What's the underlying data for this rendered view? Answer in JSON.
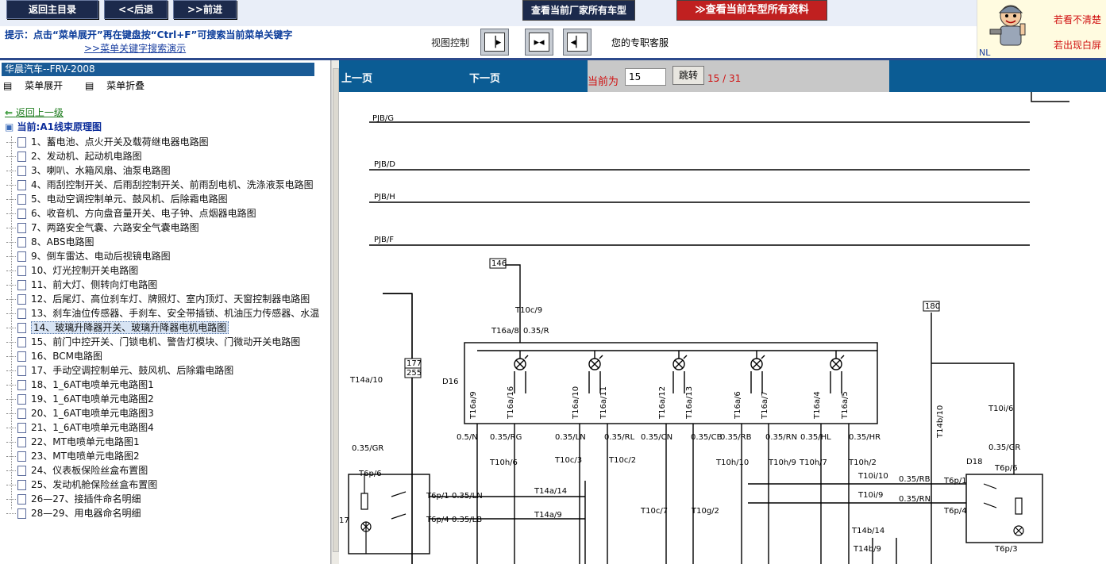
{
  "toolbar": {
    "home": "返回主目录",
    "back": "<<后退",
    "forward": ">>前进",
    "all_models": "查看当前厂家所有车型",
    "all_docs": "查看当前车型所有资料"
  },
  "hint": {
    "text": "提示：点击“菜单展开”再在键盘按“Ctrl+F”可搜索当前菜单关键字",
    "link": ">>菜单关键字搜索演示"
  },
  "view_control": {
    "label": "视图控制"
  },
  "service": "您的专职客服",
  "ad": {
    "line1": "若看不清楚",
    "line2": "若出现白屏",
    "nl": "NL"
  },
  "tree": {
    "title": "华晨汽车--FRV-2008",
    "expand": "菜单展开",
    "collapse": "菜单折叠",
    "back": "返回上一级",
    "current": "当前:A1线束原理图",
    "items": [
      "1、蓄电池、点火开关及载荷继电器电路图",
      "2、发动机、起动机电路图",
      "3、喇叭、水箱风扇、油泵电路图",
      "4、雨刮控制开关、后雨刮控制开关、前雨刮电机、洗涤液泵电路图",
      "5、电动空调控制单元、鼓风机、后除霜电路图",
      "6、收音机、方向盘音量开关、电子钟、点烟器电路图",
      "7、两路安全气囊、六路安全气囊电路图",
      "8、ABS电路图",
      "9、倒车雷达、电动后视镜电路图",
      "10、灯光控制开关电路图",
      "11、前大灯、侧转向灯电路图",
      "12、后尾灯、高位刹车灯、牌照灯、室内顶灯、天窗控制器电路图",
      "13、刹车油位传感器、手刹车、安全带插锁、机油压力传感器、水温",
      "14、玻璃升降器开关、玻璃升降器电机电路图",
      "15、前门中控开关、门锁电机、警告灯模块、门微动开关电路图",
      "16、BCM电路图",
      "17、手动空调控制单元、鼓风机、后除霜电路图",
      "18、1_6AT电喷单元电路图1",
      "19、1_6AT电喷单元电路图2",
      "20、1_6AT电喷单元电路图3",
      "21、1_6AT电喷单元电路图4",
      "22、MT电喷单元电路图1",
      "23、MT电喷单元电路图2",
      "24、仪表板保险丝盒布置图",
      "25、发动机舱保险丝盒布置图",
      "26—27、接插件命名明细",
      "28—29、用电器命名明细"
    ],
    "selected_index": 13
  },
  "nav": {
    "prev": "上一页",
    "next": "下一页",
    "current_label": "当前为",
    "page_value": "15",
    "jump": "跳转",
    "count": "15 / 31"
  },
  "diagram": {
    "buses": [
      "PJB/G",
      "PJB/D",
      "PJB/H",
      "PJB/F"
    ],
    "boxes": [
      "146",
      "177",
      "255",
      "180"
    ],
    "component_left": "D16",
    "component_right": "D18",
    "pins_top": [
      "T16a/9",
      "T16a/16",
      "T16a/10",
      "T16a/11",
      "T16a/12",
      "T16a/13",
      "T16a/6",
      "T16a/7",
      "T16a/4",
      "T16a/5"
    ],
    "wires": [
      "0.5/N",
      "0.35/RG",
      "0.35/LN",
      "0.35/RL",
      "0.35/CN",
      "0.35/CB",
      "0.35/RB",
      "0.35/RN",
      "0.35/HL",
      "0.35/HR"
    ],
    "labels": {
      "t10c9": "T10c/9",
      "t16a8": "T16a/8",
      "r035": "0.35/R",
      "t14a10": "T14a/10",
      "gr_left": "0.35/GR",
      "t6p6_left": "T6p/6",
      "t6p1_left": "T6p/1",
      "ln_mid": "0.35/LN",
      "t6p4_left": "T6p/4",
      "lb_mid": "0.35/LB",
      "t14a14": "T14a/14",
      "t14a9": "T14a/9",
      "t10h6": "T10h/6",
      "t10c3": "T10c/3",
      "t10c2": "T10c/2",
      "t10c7": "T10c/7",
      "t10g2": "T10g/2",
      "t10h10": "T10h/10",
      "t10h9": "T10h/9",
      "t10h7": "T10h/7",
      "t10h2": "T10h/2",
      "t10i10": "T10i/10",
      "t10i9": "T10i/9",
      "rb_right": "0.35/RB",
      "rn_right": "0.35/RN",
      "t14b10": "T14b/10",
      "t14b14": "T14b/14",
      "t14b9": "T14b/9",
      "t10i6": "T10i/6",
      "gr_right": "0.35/GR",
      "t6p6_right": "T6p/6",
      "t6p1_right": "T6p/1",
      "t6p4_right": "T6p/4",
      "t6p3_right": "T6p/3",
      "num17": "17"
    }
  }
}
